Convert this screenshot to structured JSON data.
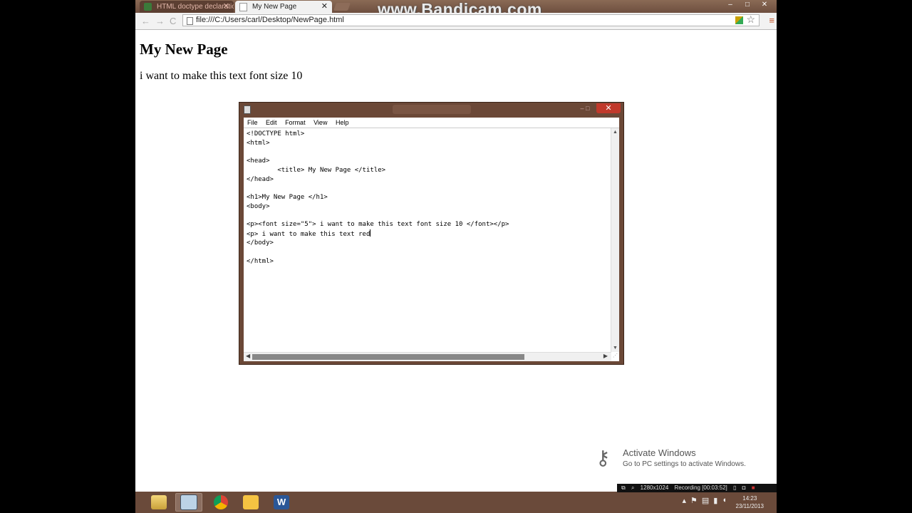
{
  "browser": {
    "tabs": [
      {
        "label": "HTML doctype declaration",
        "active": false
      },
      {
        "label": "My New Page",
        "active": true
      }
    ],
    "watermark": "www.Bandicam.com",
    "window_controls": {
      "minimize": "–",
      "maximize": "□",
      "close": "✕"
    },
    "nav": {
      "back": "←",
      "forward": "→",
      "reload": "C"
    },
    "address": "file:///C:/Users/carl/Desktop/NewPage.html",
    "menu_glyph": "≡"
  },
  "page": {
    "heading": "My New Page",
    "paragraph": "i want to make this text font size 10"
  },
  "notepad": {
    "close_glyph": "✕",
    "menu": [
      "File",
      "Edit",
      "Format",
      "View",
      "Help"
    ],
    "lines": [
      "<!DOCTYPE html>",
      "<html>",
      "",
      "<head>",
      "        <title> My New Page </title>",
      "</head>",
      "",
      "<h1>My New Page </h1>",
      "<body>",
      "",
      "<p><font size=\"5\"> i want to make this text font size 10 </font></p>",
      "<p> i want to make this text red",
      "</body>",
      "",
      "</html>"
    ]
  },
  "activate_windows": {
    "title": "Activate Windows",
    "subtitle": "Go to PC settings to activate Windows."
  },
  "recorder": {
    "resolution": "1280x1024",
    "status": "Recording [00:03:52]"
  },
  "taskbar": {
    "time": "14:23",
    "date": "23/11/2013"
  },
  "colors": {
    "frame": "#6b4b3b",
    "close_red": "#c1392b",
    "chrome_menu": "#c2552a"
  }
}
